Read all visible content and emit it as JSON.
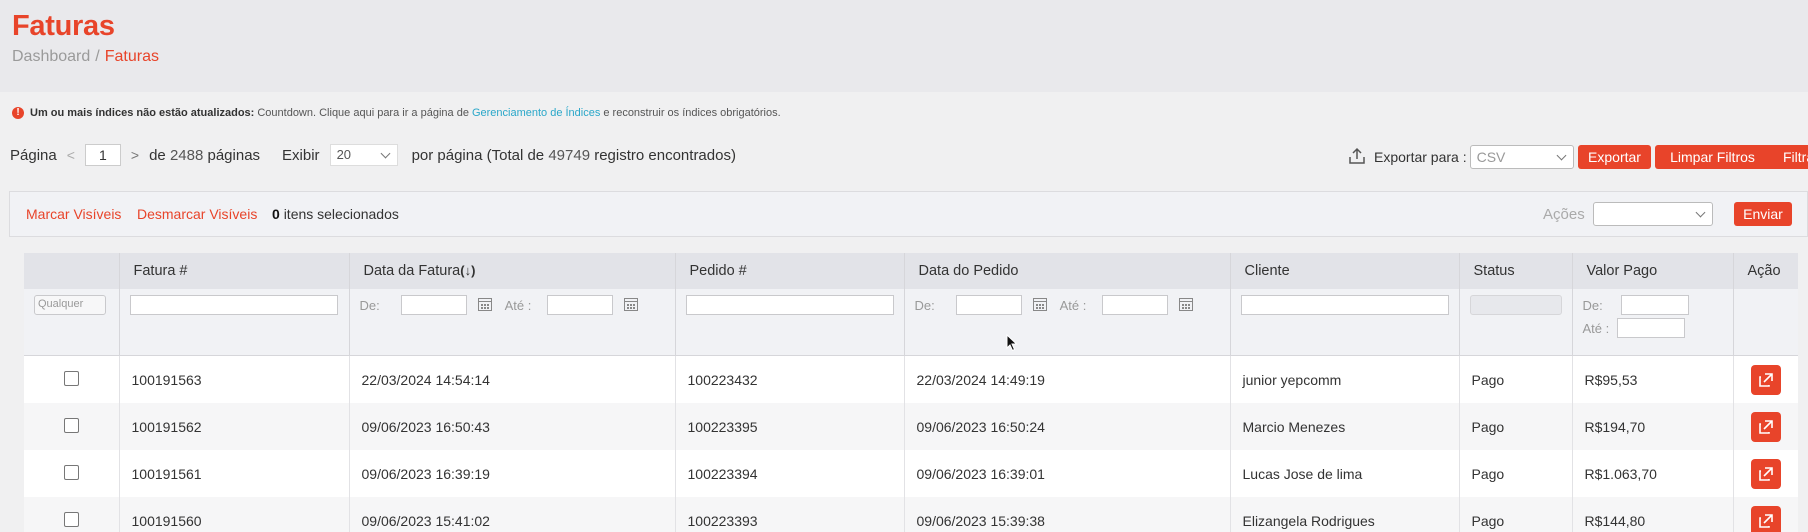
{
  "header": {
    "title": "Faturas",
    "breadcrumb": {
      "home": "Dashboard",
      "separator": "/",
      "current": "Faturas"
    }
  },
  "alert": {
    "bold": "Um ou mais índices não estão atualizados:",
    "text_before": "Countdown. Clique aqui para ir a página de",
    "link": "Gerenciamento de Índices",
    "text_after": "e reconstruir os índices obrigatórios."
  },
  "pager": {
    "page_label": "Página",
    "prev": "<",
    "current_page": "1",
    "next": ">",
    "of_label": "de",
    "total_pages": "2488",
    "pages_label": "páginas",
    "show_label": "Exibir",
    "per_page": "20",
    "per_page_label": "por página (Total de",
    "total_records": "49749",
    "records_label": "registro encontrados)"
  },
  "export": {
    "label": "Exportar para :",
    "format": "CSV",
    "export_button": "Exportar",
    "clear_button": "Limpar Filtros",
    "filter_button": "Filtrar"
  },
  "massaction": {
    "select_visible": "Marcar Visíveis",
    "unselect_visible": "Desmarcar Visíveis",
    "selected_count": "0",
    "selected_label": "itens selecionados",
    "actions_label": "Ações",
    "actions_value": "",
    "submit": "Enviar"
  },
  "grid": {
    "columns": {
      "invoice": "Fatura #",
      "invoice_date": "Data da Fatura",
      "order": "Pedido #",
      "order_date": "Data do Pedido",
      "customer": "Cliente",
      "status": "Status",
      "paid": "Valor Pago",
      "action": "Ação"
    },
    "sort_indicator": "(↓)",
    "filters": {
      "any": "Qualquer",
      "from": "De:",
      "to": "Até :",
      "to_short": "Até :"
    },
    "rows": [
      {
        "invoice": "100191563",
        "invoice_date": "22/03/2024 14:54:14",
        "order": "100223432",
        "order_date": "22/03/2024 14:49:19",
        "customer": "junior yepcomm",
        "status": "Pago",
        "paid": "R$95,53"
      },
      {
        "invoice": "100191562",
        "invoice_date": "09/06/2023 16:50:43",
        "order": "100223395",
        "order_date": "09/06/2023 16:50:24",
        "customer": "Marcio Menezes",
        "status": "Pago",
        "paid": "R$194,70"
      },
      {
        "invoice": "100191561",
        "invoice_date": "09/06/2023 16:39:19",
        "order": "100223394",
        "order_date": "09/06/2023 16:39:01",
        "customer": "Lucas Jose de lima",
        "status": "Pago",
        "paid": "R$1.063,70"
      },
      {
        "invoice": "100191560",
        "invoice_date": "09/06/2023 15:41:02",
        "order": "100223393",
        "order_date": "09/06/2023 15:39:38",
        "customer": "Elizangela Rodrigues",
        "status": "Pago",
        "paid": "R$144,80"
      }
    ]
  },
  "colors": {
    "accent": "#e8442a",
    "link": "#2aa7c9",
    "header_bg": "#e9e9ec"
  },
  "icons": [
    "alert-icon",
    "upload-icon",
    "calendar-icon",
    "external-link-icon",
    "chevron-down-icon",
    "mouse-cursor-icon"
  ]
}
